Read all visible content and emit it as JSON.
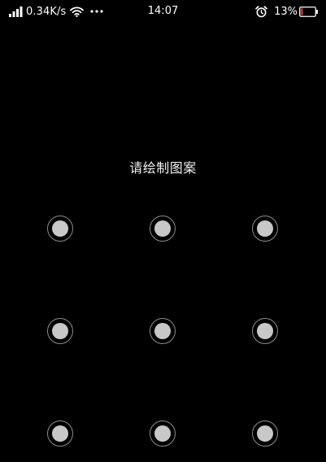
{
  "status_bar": {
    "signal_icon": "cellular-signal-icon",
    "network_speed": "0.34K/s",
    "wifi_icon": "wifi-icon",
    "more_icon": "more-dots-icon",
    "time": "14:07",
    "alarm_icon": "alarm-clock-icon",
    "battery_percent": "13%",
    "battery_icon": "battery-low-icon",
    "battery_level": 0.13,
    "battery_color": "#e53935"
  },
  "lock_screen": {
    "prompt": "请绘制图案",
    "pattern_nodes": [
      1,
      2,
      3,
      4,
      5,
      6,
      7,
      8,
      9
    ],
    "node_color": "#c8c8c8",
    "ring_color": "#8c8c8c"
  }
}
